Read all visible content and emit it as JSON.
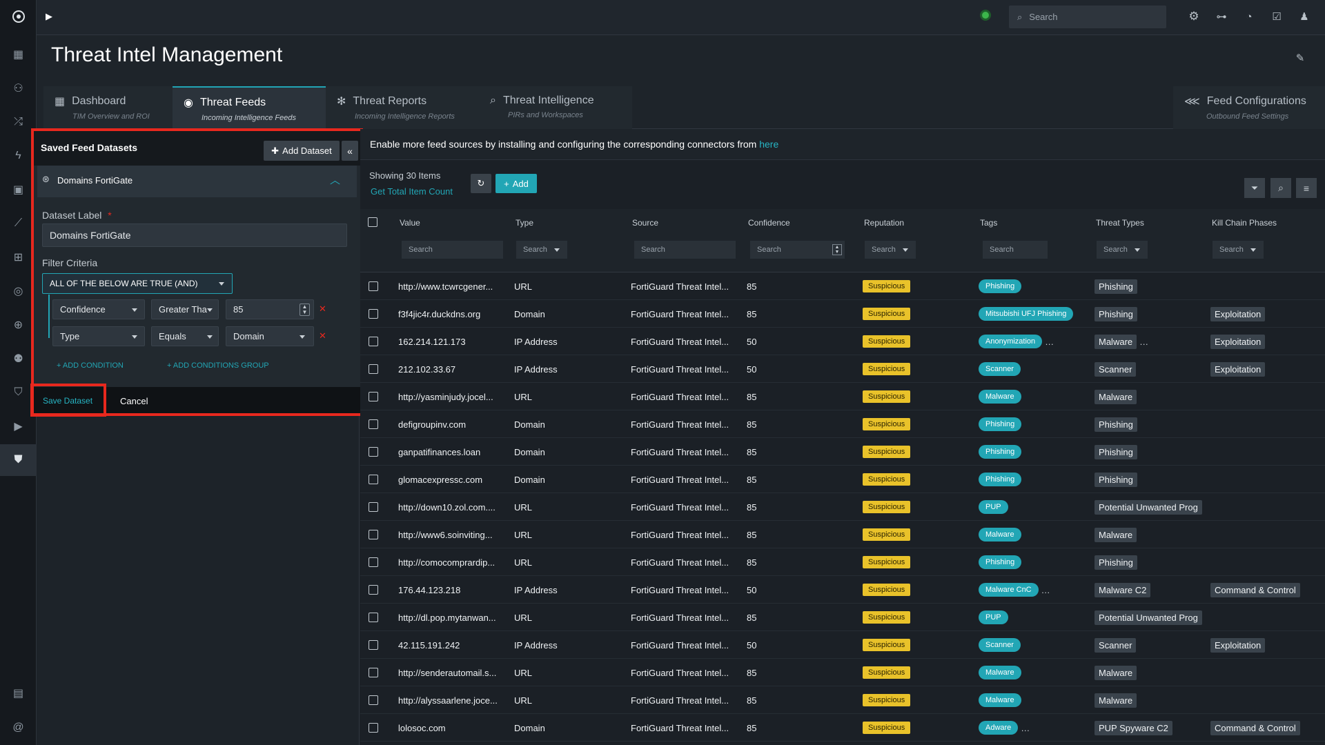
{
  "app": {
    "title": "Threat Intel Management",
    "search_placeholder": "Search",
    "colors": {
      "accent": "#22a6b5",
      "highlight": "#e8281e",
      "reputation": "#e9c22a",
      "status_dot": "#3cb64b"
    }
  },
  "sidebar_icons": [
    "menu-expand-icon",
    "dashboard-grid-icon",
    "users-group-icon",
    "shuffle-icon",
    "lightning-icon",
    "briefcase-icon",
    "chart-line-icon",
    "apps-icon",
    "target-icon",
    "globe-icon",
    "people-icon",
    "shield-icon",
    "play-icon",
    "shield-active-icon",
    "clipboard-icon",
    "at-icon"
  ],
  "tabs": [
    {
      "label": "Dashboard",
      "sub": "TIM Overview and ROI",
      "icon": "grid-icon"
    },
    {
      "label": "Threat Feeds",
      "sub": "Incoming Intelligence Feeds",
      "icon": "radar-icon"
    },
    {
      "label": "Threat Reports",
      "sub": "Incoming Intelligence Reports",
      "icon": "bug-icon"
    },
    {
      "label": "Threat Intelligence",
      "sub": "PIRs and Workspaces",
      "icon": "search-icon"
    },
    {
      "label": "Feed Configurations",
      "sub": "Outbound Feed Settings",
      "icon": "broadcast-icon"
    }
  ],
  "panel": {
    "title": "Saved Feed Datasets",
    "add_dataset": "Add Dataset",
    "dataset_name": "Domains FortiGate",
    "dataset_label_title": "Dataset Label",
    "required_mark": "*",
    "dataset_label_value": "Domains FortiGate",
    "filter_criteria": "Filter Criteria",
    "logic_select": "ALL OF THE BELOW ARE TRUE (AND)",
    "conditions": [
      {
        "field": "Confidence",
        "op": "Greater Tha",
        "value": "85"
      },
      {
        "field": "Type",
        "op": "Equals",
        "value": "Domain"
      }
    ],
    "add_condition": "+ ADD CONDITION",
    "add_group": "+ ADD CONDITIONS GROUP",
    "save": "Save Dataset",
    "cancel": "Cancel"
  },
  "banner": {
    "text": "Enable more feed sources by installing and configuring the corresponding connectors from ",
    "link": "here"
  },
  "toolbar": {
    "showing": "Showing 30 Items",
    "total_count": "Get Total Item Count",
    "add": "Add"
  },
  "columns": [
    "Value",
    "Type",
    "Source",
    "Confidence",
    "Reputation",
    "Tags",
    "Threat Types",
    "Kill Chain Phases"
  ],
  "column_search": "Search",
  "rows": [
    {
      "value": "http://www.tcwrcgener...",
      "type": "URL",
      "source": "FortiGuard Threat Intel...",
      "confidence": "85",
      "reputation": "Suspicious",
      "tag": "Phishing",
      "tag_more": false,
      "threat": "Phishing",
      "threat_more": false,
      "kill": ""
    },
    {
      "value": "f3f4jic4r.duckdns.org",
      "type": "Domain",
      "source": "FortiGuard Threat Intel...",
      "confidence": "85",
      "reputation": "Suspicious",
      "tag": "Mitsubishi UFJ Phishing",
      "tag_more": false,
      "threat": "Phishing",
      "threat_more": false,
      "kill": "Exploitation"
    },
    {
      "value": "162.214.121.173",
      "type": "IP Address",
      "source": "FortiGuard Threat Intel...",
      "confidence": "50",
      "reputation": "Suspicious",
      "tag": "Anonymization",
      "tag_more": true,
      "threat": "Malware",
      "threat_more": true,
      "kill": "Exploitation"
    },
    {
      "value": "212.102.33.67",
      "type": "IP Address",
      "source": "FortiGuard Threat Intel...",
      "confidence": "50",
      "reputation": "Suspicious",
      "tag": "Scanner",
      "tag_more": false,
      "threat": "Scanner",
      "threat_more": false,
      "kill": "Exploitation"
    },
    {
      "value": "http://yasminjudy.jocel...",
      "type": "URL",
      "source": "FortiGuard Threat Intel...",
      "confidence": "85",
      "reputation": "Suspicious",
      "tag": "Malware",
      "tag_more": false,
      "threat": "Malware",
      "threat_more": false,
      "kill": ""
    },
    {
      "value": "defigroupinv.com",
      "type": "Domain",
      "source": "FortiGuard Threat Intel...",
      "confidence": "85",
      "reputation": "Suspicious",
      "tag": "Phishing",
      "tag_more": false,
      "threat": "Phishing",
      "threat_more": false,
      "kill": ""
    },
    {
      "value": "ganpatifinances.loan",
      "type": "Domain",
      "source": "FortiGuard Threat Intel...",
      "confidence": "85",
      "reputation": "Suspicious",
      "tag": "Phishing",
      "tag_more": false,
      "threat": "Phishing",
      "threat_more": false,
      "kill": ""
    },
    {
      "value": "glomacexpressc.com",
      "type": "Domain",
      "source": "FortiGuard Threat Intel...",
      "confidence": "85",
      "reputation": "Suspicious",
      "tag": "Phishing",
      "tag_more": false,
      "threat": "Phishing",
      "threat_more": false,
      "kill": ""
    },
    {
      "value": "http://down10.zol.com....",
      "type": "URL",
      "source": "FortiGuard Threat Intel...",
      "confidence": "85",
      "reputation": "Suspicious",
      "tag": "PUP",
      "tag_more": false,
      "threat": "Potential Unwanted Prog",
      "threat_more": false,
      "kill": ""
    },
    {
      "value": "http://www6.soinviting...",
      "type": "URL",
      "source": "FortiGuard Threat Intel...",
      "confidence": "85",
      "reputation": "Suspicious",
      "tag": "Malware",
      "tag_more": false,
      "threat": "Malware",
      "threat_more": false,
      "kill": ""
    },
    {
      "value": "http://comocomprardip...",
      "type": "URL",
      "source": "FortiGuard Threat Intel...",
      "confidence": "85",
      "reputation": "Suspicious",
      "tag": "Phishing",
      "tag_more": false,
      "threat": "Phishing",
      "threat_more": false,
      "kill": ""
    },
    {
      "value": "176.44.123.218",
      "type": "IP Address",
      "source": "FortiGuard Threat Intel...",
      "confidence": "50",
      "reputation": "Suspicious",
      "tag": "Malware CnC",
      "tag_more": true,
      "threat": "Malware C2",
      "threat_more": false,
      "kill": "Command & Control"
    },
    {
      "value": "http://dl.pop.mytanwan...",
      "type": "URL",
      "source": "FortiGuard Threat Intel...",
      "confidence": "85",
      "reputation": "Suspicious",
      "tag": "PUP",
      "tag_more": false,
      "threat": "Potential Unwanted Prog",
      "threat_more": false,
      "kill": ""
    },
    {
      "value": "42.115.191.242",
      "type": "IP Address",
      "source": "FortiGuard Threat Intel...",
      "confidence": "50",
      "reputation": "Suspicious",
      "tag": "Scanner",
      "tag_more": false,
      "threat": "Scanner",
      "threat_more": false,
      "kill": "Exploitation"
    },
    {
      "value": "http://senderautomail.s...",
      "type": "URL",
      "source": "FortiGuard Threat Intel...",
      "confidence": "85",
      "reputation": "Suspicious",
      "tag": "Malware",
      "tag_more": false,
      "threat": "Malware",
      "threat_more": false,
      "kill": ""
    },
    {
      "value": "http://alyssaarlene.joce...",
      "type": "URL",
      "source": "FortiGuard Threat Intel...",
      "confidence": "85",
      "reputation": "Suspicious",
      "tag": "Malware",
      "tag_more": false,
      "threat": "Malware",
      "threat_more": false,
      "kill": ""
    },
    {
      "value": "lolosoc.com",
      "type": "Domain",
      "source": "FortiGuard Threat Intel...",
      "confidence": "85",
      "reputation": "Suspicious",
      "tag": "Adware",
      "tag_more": true,
      "threat": "PUP Spyware C2",
      "threat_more": false,
      "kill": "Command & Control"
    }
  ]
}
